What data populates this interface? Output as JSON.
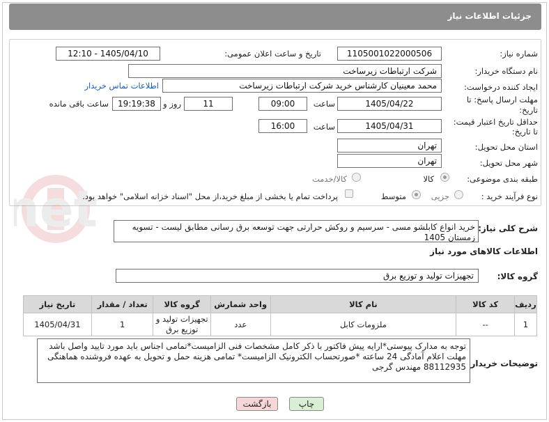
{
  "header": {
    "title": "جزئیات اطلاعات نیاز"
  },
  "form": {
    "need_number_label": "شماره نیاز:",
    "need_number": "1105001022000506",
    "announce_label": "تاریخ و ساعت اعلان عمومی:",
    "announce_value": "1405/04/10 - 12:10",
    "buyer_org_label": "نام دستگاه خریدار:",
    "buyer_org": "شرکت ارتباطات زیرساخت",
    "creator_label": "ایجاد کننده درخواست:",
    "creator": "محمد معینیان کارشناس خرید شرکت ارتباطات زیرساخت",
    "contact_link": "اطلاعات تماس خریدار",
    "deadline_label_1": "مهلت ارسال پاسخ: تا",
    "deadline_label_2": "تاریخ:",
    "deadline_date": "1405/04/22",
    "time_label": "ساعت",
    "deadline_time": "09:00",
    "days_value": "11",
    "days_label": "روز و",
    "remaining_time": "19:19:38",
    "remaining_label": "ساعت باقی مانده",
    "validity_label_1": "حداقل تاریخ اعتبار قیمت:",
    "validity_label_2": "تا تاریخ:",
    "validity_date": "1405/04/31",
    "validity_time": "16:00",
    "province_label": "استان محل تحویل:",
    "province": "تهران",
    "city_label": "شهر محل تحویل:",
    "city": "تهران",
    "category_label": "طبقه بندی موضوعی:",
    "category_options": [
      "کالا",
      "کالا/خدمت"
    ],
    "process_label": "نوع فرآیند خرید :",
    "process_options": [
      "جزیی",
      "متوسط"
    ],
    "payment_note": "پرداخت تمام یا بخشی از مبلغ خرید،از محل \"اسناد خزانه اسلامی\" خواهد بود."
  },
  "description": {
    "label": "شرح کلی نیاز:",
    "text": "خرید انواع کابلشو مسی - سرسیم و روکش حرارتی جهت توسعه برق رسانی مطابق لیست -    تسویه زمستان 1405"
  },
  "items_section": {
    "title": "اطلاعات کالاهای مورد نیاز",
    "group_label": "گروه کالا:",
    "group_value": "تجهیزات تولید و توزیع برق",
    "columns": [
      "ردیف",
      "کد کالا",
      "نام کالا",
      "واحد شمارش",
      "گروه کالا",
      "تعداد / مقدار",
      "تاریخ نیاز"
    ],
    "rows": [
      {
        "index": "1",
        "code": "--",
        "name": "ملزومات کابل",
        "unit": "عدد",
        "group": "تجهیزات تولید و توزیع برق",
        "qty": "1",
        "date": "1405/04/31"
      }
    ]
  },
  "buyer_notes": {
    "label": "توضیحات خریدار:",
    "text": "توجه به مدارک پیوستی*ارایه پیش فاکتور با ذکر کامل مشخصات فنی الزامیست*تمامی اجناس باید مورد تایید واصل باشد مهلت اعلام آمادگی 24 ساعته *صورتحساب الکترونیک الزامیست* تمامی هزینه حمل و تحویل به عهده فروشنده هماهنگی 88112935 مهندس گرجی"
  },
  "buttons": {
    "print": "چاپ",
    "back": "بازگشت"
  },
  "watermark_text": "AriaTender.net",
  "colors": {
    "title_bar": "#8d8d8d",
    "link": "#1a5bb5",
    "back_button": "#f6d6d6",
    "print_button": "#d9efd4",
    "table_header": "#d9d9d9"
  }
}
